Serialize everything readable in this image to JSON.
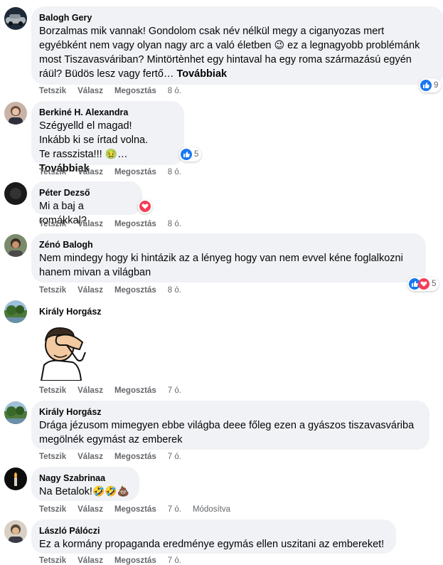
{
  "actions": {
    "like": "Tetszik",
    "reply": "Válasz",
    "share": "Megosztás"
  },
  "comments": [
    {
      "author": "Balogh Gery",
      "text": "Borzalmas mik vannak! Gondolom csak név nélkül megy a ciganyozas mert\negyébként nem vagy olyan nagy arc a való életben ",
      "text2": " ez a legnagyobb problémánk\nmost Tiszavasváriban? Mintörtènhet egy hintaval ha egy roma származású egyén\nráül? Büdös lesz vagy fertő… ",
      "more": "Továbbiak",
      "time": "8 ó.",
      "reactions": "9"
    },
    {
      "author": "Berkiné H. Alexandra",
      "text": "Szégyelld el magad!\nInkább ki se írtad volna.\nTe rasszista!!! ",
      "text2": "… ",
      "more": "Továbbiak",
      "time": "8 ó.",
      "reactions": "5"
    },
    {
      "author": "Péter Dezső",
      "text": "Mi a baj a romákkal?",
      "time": "8 ó."
    },
    {
      "author": "Zénó Balogh",
      "text": "Nem mindegy hogy ki hintázik az a lényeg hogy van nem evvel kéne foglalkozni\nhanem mivan a világban",
      "time": "8 ó.",
      "reactions": "5"
    },
    {
      "author": "Király Horgász",
      "text": "",
      "time": "7 ó."
    },
    {
      "author": "Király Horgász",
      "text": "Drága jézusom mimegyen ebbe világba deee főleg ezen a gyászos tiszavasváriba\nmegölnék egymást az emberek",
      "time": "7 ó."
    },
    {
      "author": "Nagy Szabrinaa",
      "text": "Na Betalok!",
      "time": "7 ó.",
      "edited": "Módosítva"
    },
    {
      "author": "László Pálóczi",
      "text": "Ez a kormány propaganda eredménye egymás ellen uszitani az embereket!",
      "time": "7 ó."
    }
  ],
  "colors": {
    "bubble": "#f0f2f5",
    "meta": "#65676b",
    "like": "#1877f2",
    "love": "#f33e58"
  }
}
